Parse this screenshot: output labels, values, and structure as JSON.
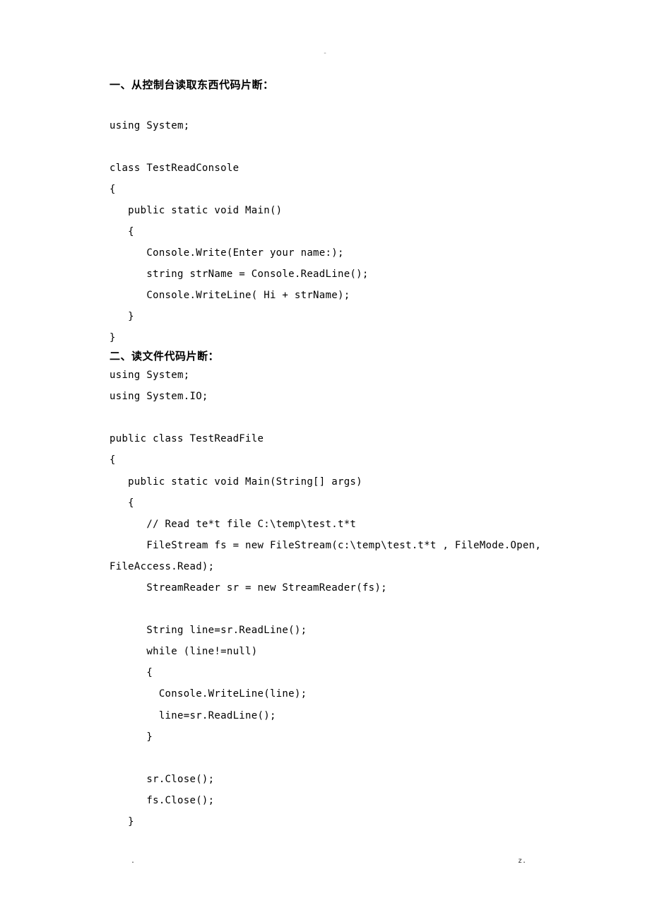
{
  "header": {
    "dash": "-"
  },
  "section1": {
    "heading": "一、从控制台读取东西代码片断：",
    "code": "using System;\n\nclass TestReadConsole\n{\n   public static void Main()\n   {\n      Console.Write(Enter your name:);\n      string strName = Console.ReadLine();\n      Console.WriteLine( Hi + strName);\n   }\n}"
  },
  "section2": {
    "heading": "二、读文件代码片断：",
    "code": "using System;\nusing System.IO;\n\npublic class TestReadFile\n{\n   public static void Main(String[] args)\n   {\n      // Read te*t file C:\\temp\\test.t*t\n      FileStream fs = new FileStream(c:\\temp\\test.t*t , FileMode.Open,\nFileAccess.Read);\n      StreamReader sr = new StreamReader(fs);\n\n      String line=sr.ReadLine();\n      while (line!=null)\n      {\n        Console.WriteLine(line);\n        line=sr.ReadLine();\n      }\n\n      sr.Close();\n      fs.Close();\n   }"
  },
  "footer": {
    "left": ".",
    "right": "z."
  }
}
